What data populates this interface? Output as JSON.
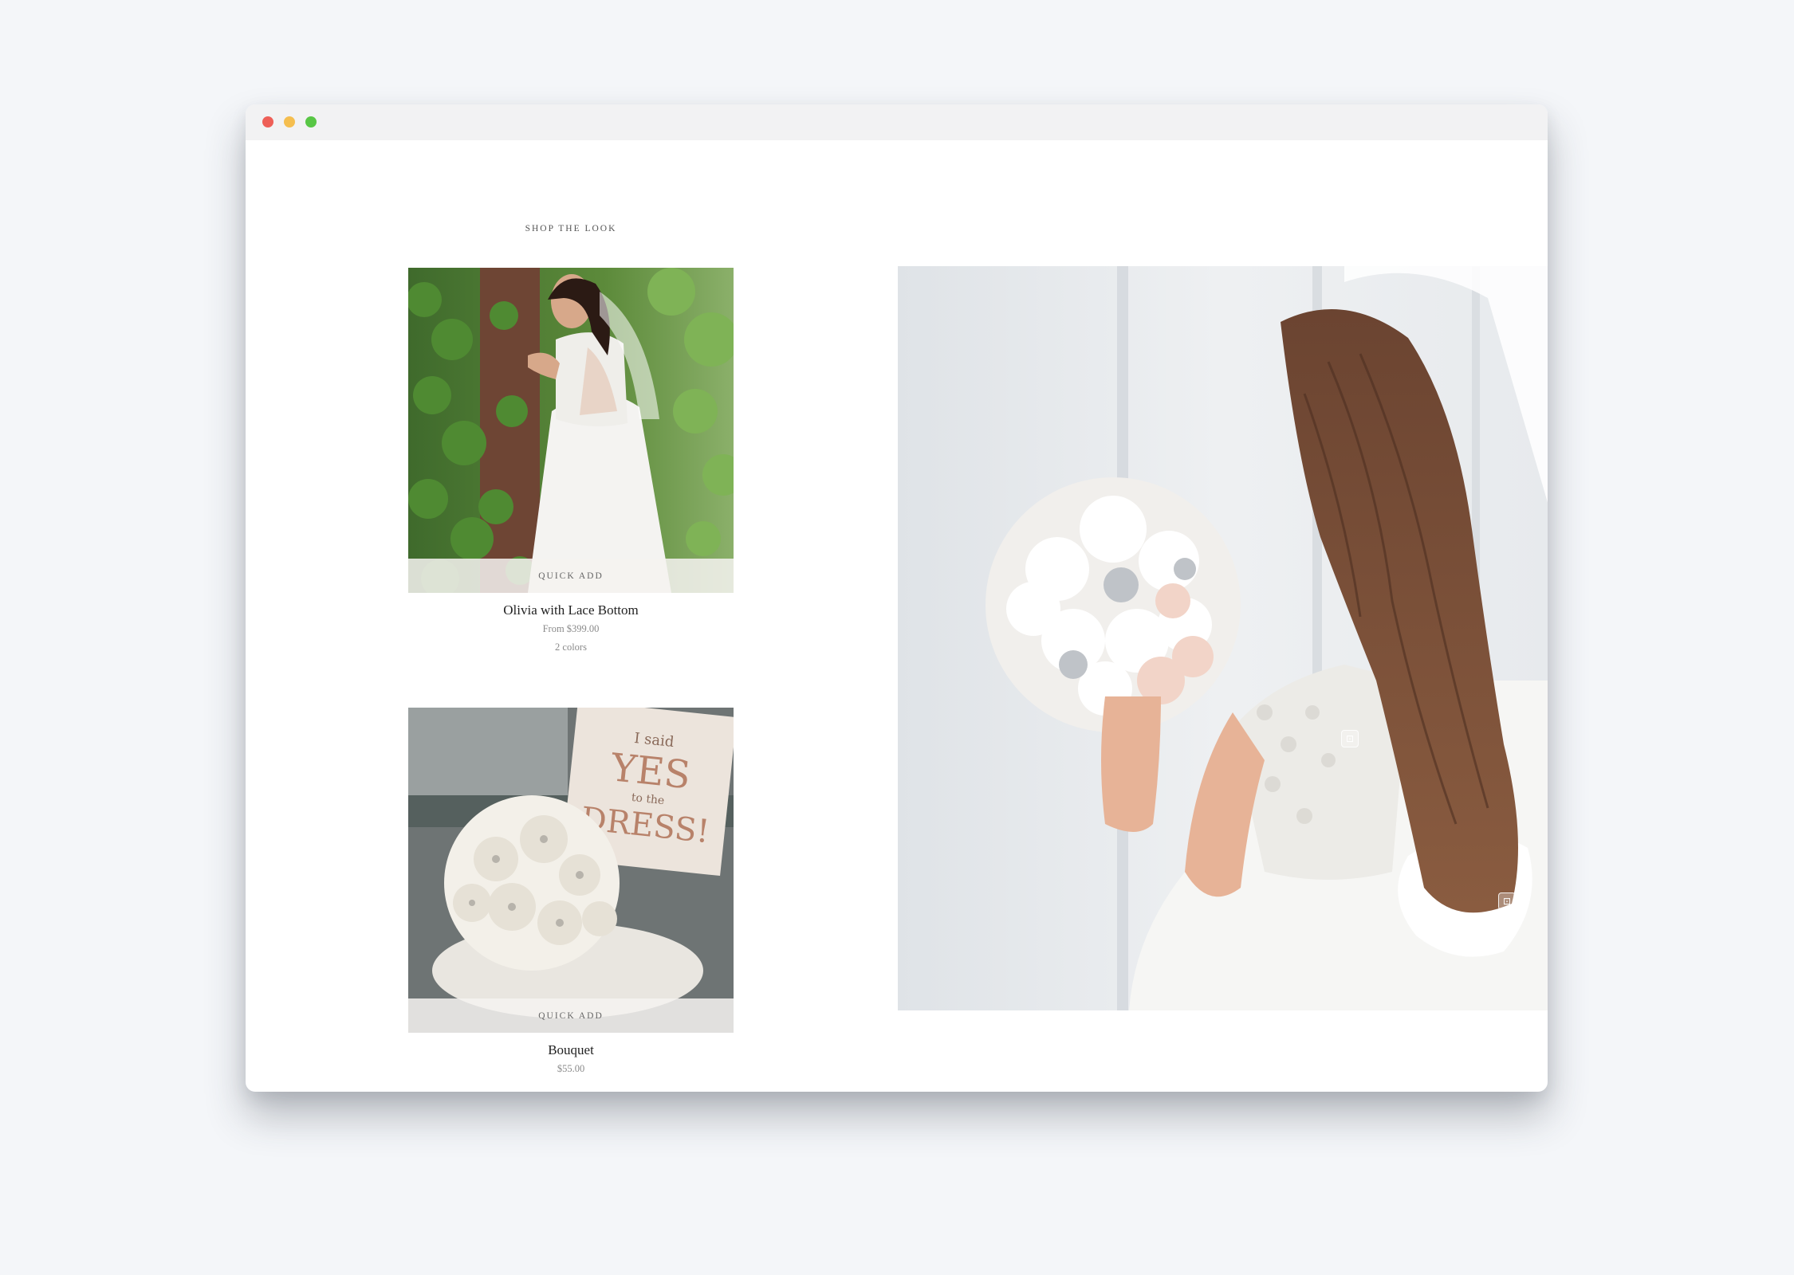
{
  "section": {
    "title": "SHOP THE LOOK"
  },
  "products": [
    {
      "name": "Olivia with Lace Bottom",
      "price": "From $399.00",
      "swatches": "2 colors",
      "quick_add_label": "QUICK ADD"
    },
    {
      "name": "Bouquet",
      "price": "$55.00",
      "quick_add_label": "QUICK ADD"
    }
  ],
  "thumb_sign": {
    "line1": "I said",
    "line2": "YES",
    "line3": "to the",
    "line4": "DRESS!"
  },
  "hotspots": [
    {
      "icon": "shopping-bag-icon",
      "glyph": "⊡"
    },
    {
      "icon": "shopping-bag-icon",
      "glyph": "⊡"
    }
  ],
  "colors": {
    "page_bg": "#f4f6f9",
    "window_bg": "#ffffff",
    "titlebar_bg": "#f2f2f3"
  }
}
